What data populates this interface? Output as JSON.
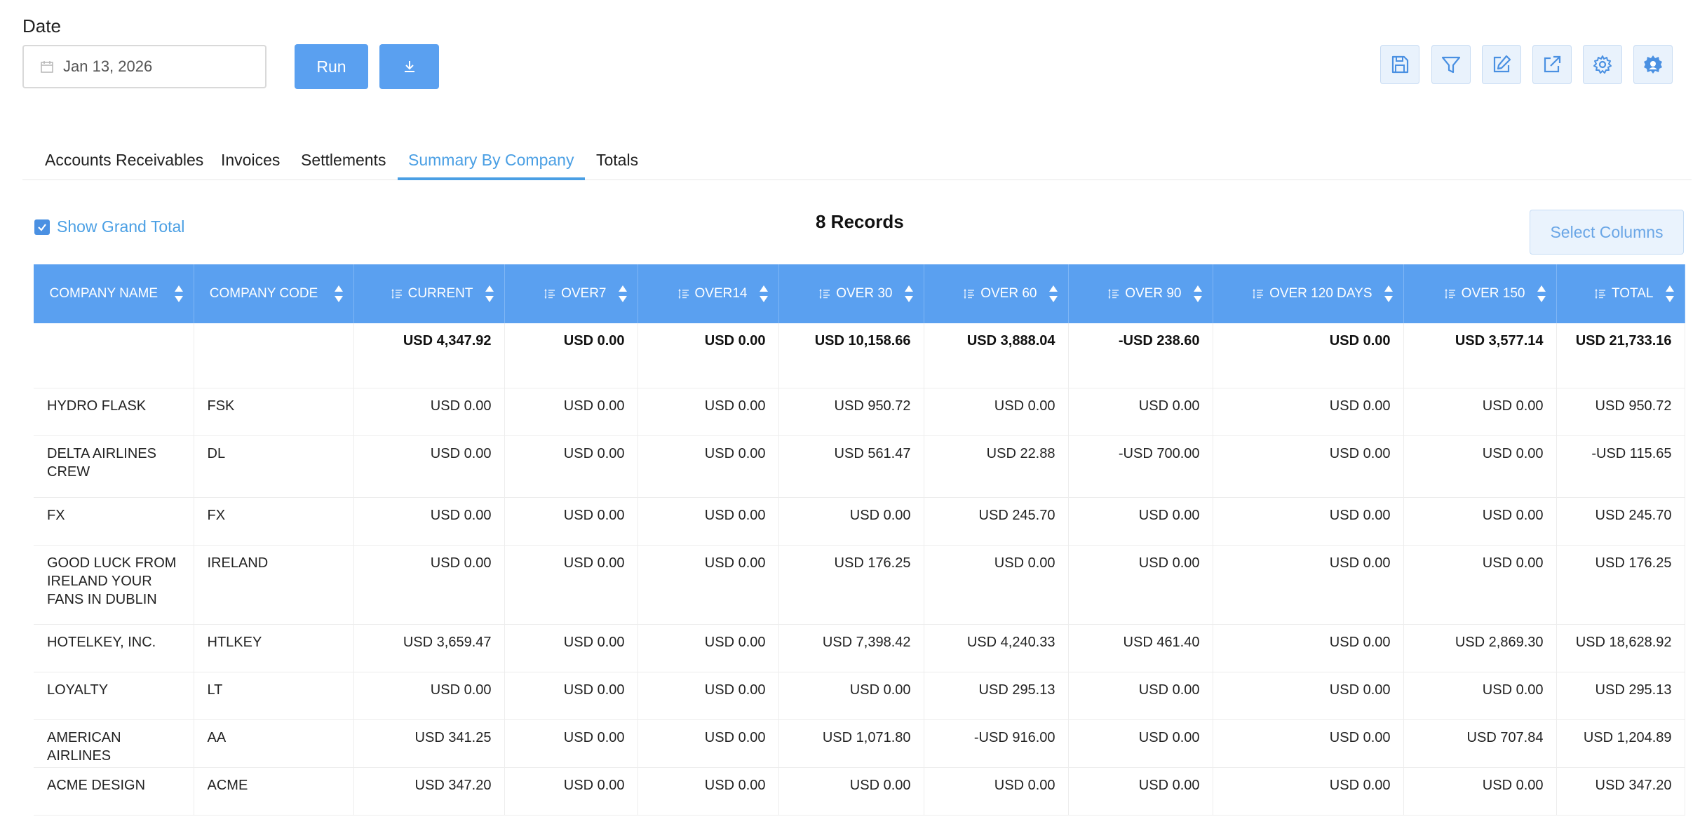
{
  "date": {
    "label": "Date",
    "value": "Jan 13, 2026"
  },
  "buttons": {
    "run": "Run"
  },
  "toolbar_icons": [
    "save-icon",
    "filter-icon",
    "edit-icon",
    "external-link-icon",
    "settings-icon",
    "admin-settings-icon"
  ],
  "tabs": [
    {
      "label": "Accounts Receivables",
      "active": false
    },
    {
      "label": "Invoices",
      "active": false
    },
    {
      "label": "Settlements",
      "active": false
    },
    {
      "label": "Summary By Company",
      "active": true
    },
    {
      "label": "Totals",
      "active": false
    }
  ],
  "options": {
    "show_grand_total_label": "Show Grand Total",
    "show_grand_total_checked": true
  },
  "records_label": "8 Records",
  "select_columns_label": "Select Columns",
  "colors": {
    "accent": "#5aa0f0",
    "link": "#4a9fe4"
  },
  "table": {
    "columns": [
      "COMPANY NAME",
      "COMPANY CODE",
      "CURRENT",
      "OVER7",
      "OVER14",
      "OVER 30",
      "OVER 60",
      "OVER 90",
      "OVER 120 DAYS",
      "OVER 150",
      "TOTAL"
    ],
    "grand_total": [
      "",
      "",
      "USD 4,347.92",
      "USD 0.00",
      "USD 0.00",
      "USD 10,158.66",
      "USD 3,888.04",
      "-USD 238.60",
      "USD 0.00",
      "USD 3,577.14",
      "USD 21,733.16"
    ],
    "rows": [
      [
        "HYDRO FLASK",
        "FSK",
        "USD 0.00",
        "USD 0.00",
        "USD 0.00",
        "USD 950.72",
        "USD 0.00",
        "USD 0.00",
        "USD 0.00",
        "USD 0.00",
        "USD 950.72"
      ],
      [
        "DELTA AIRLINES CREW",
        "DL",
        "USD 0.00",
        "USD 0.00",
        "USD 0.00",
        "USD 561.47",
        "USD 22.88",
        "-USD 700.00",
        "USD 0.00",
        "USD 0.00",
        "-USD 115.65"
      ],
      [
        "FX",
        "FX",
        "USD 0.00",
        "USD 0.00",
        "USD 0.00",
        "USD 0.00",
        "USD 245.70",
        "USD 0.00",
        "USD 0.00",
        "USD 0.00",
        "USD 245.70"
      ],
      [
        "GOOD LUCK FROM IRELAND YOUR FANS IN DUBLIN",
        "IRELAND",
        "USD 0.00",
        "USD 0.00",
        "USD 0.00",
        "USD 176.25",
        "USD 0.00",
        "USD 0.00",
        "USD 0.00",
        "USD 0.00",
        "USD 176.25"
      ],
      [
        "HOTELKEY, INC.",
        "HTLKEY",
        "USD 3,659.47",
        "USD 0.00",
        "USD 0.00",
        "USD 7,398.42",
        "USD 4,240.33",
        "USD 461.40",
        "USD 0.00",
        "USD 2,869.30",
        "USD 18,628.92"
      ],
      [
        "LOYALTY",
        "LT",
        "USD 0.00",
        "USD 0.00",
        "USD 0.00",
        "USD 0.00",
        "USD 295.13",
        "USD 0.00",
        "USD 0.00",
        "USD 0.00",
        "USD 295.13"
      ],
      [
        "AMERICAN AIRLINES",
        "AA",
        "USD 341.25",
        "USD 0.00",
        "USD 0.00",
        "USD 1,071.80",
        "-USD 916.00",
        "USD 0.00",
        "USD 0.00",
        "USD 707.84",
        "USD 1,204.89"
      ],
      [
        "ACME DESIGN",
        "ACME",
        "USD 347.20",
        "USD 0.00",
        "USD 0.00",
        "USD 0.00",
        "USD 0.00",
        "USD 0.00",
        "USD 0.00",
        "USD 0.00",
        "USD 347.20"
      ]
    ]
  }
}
